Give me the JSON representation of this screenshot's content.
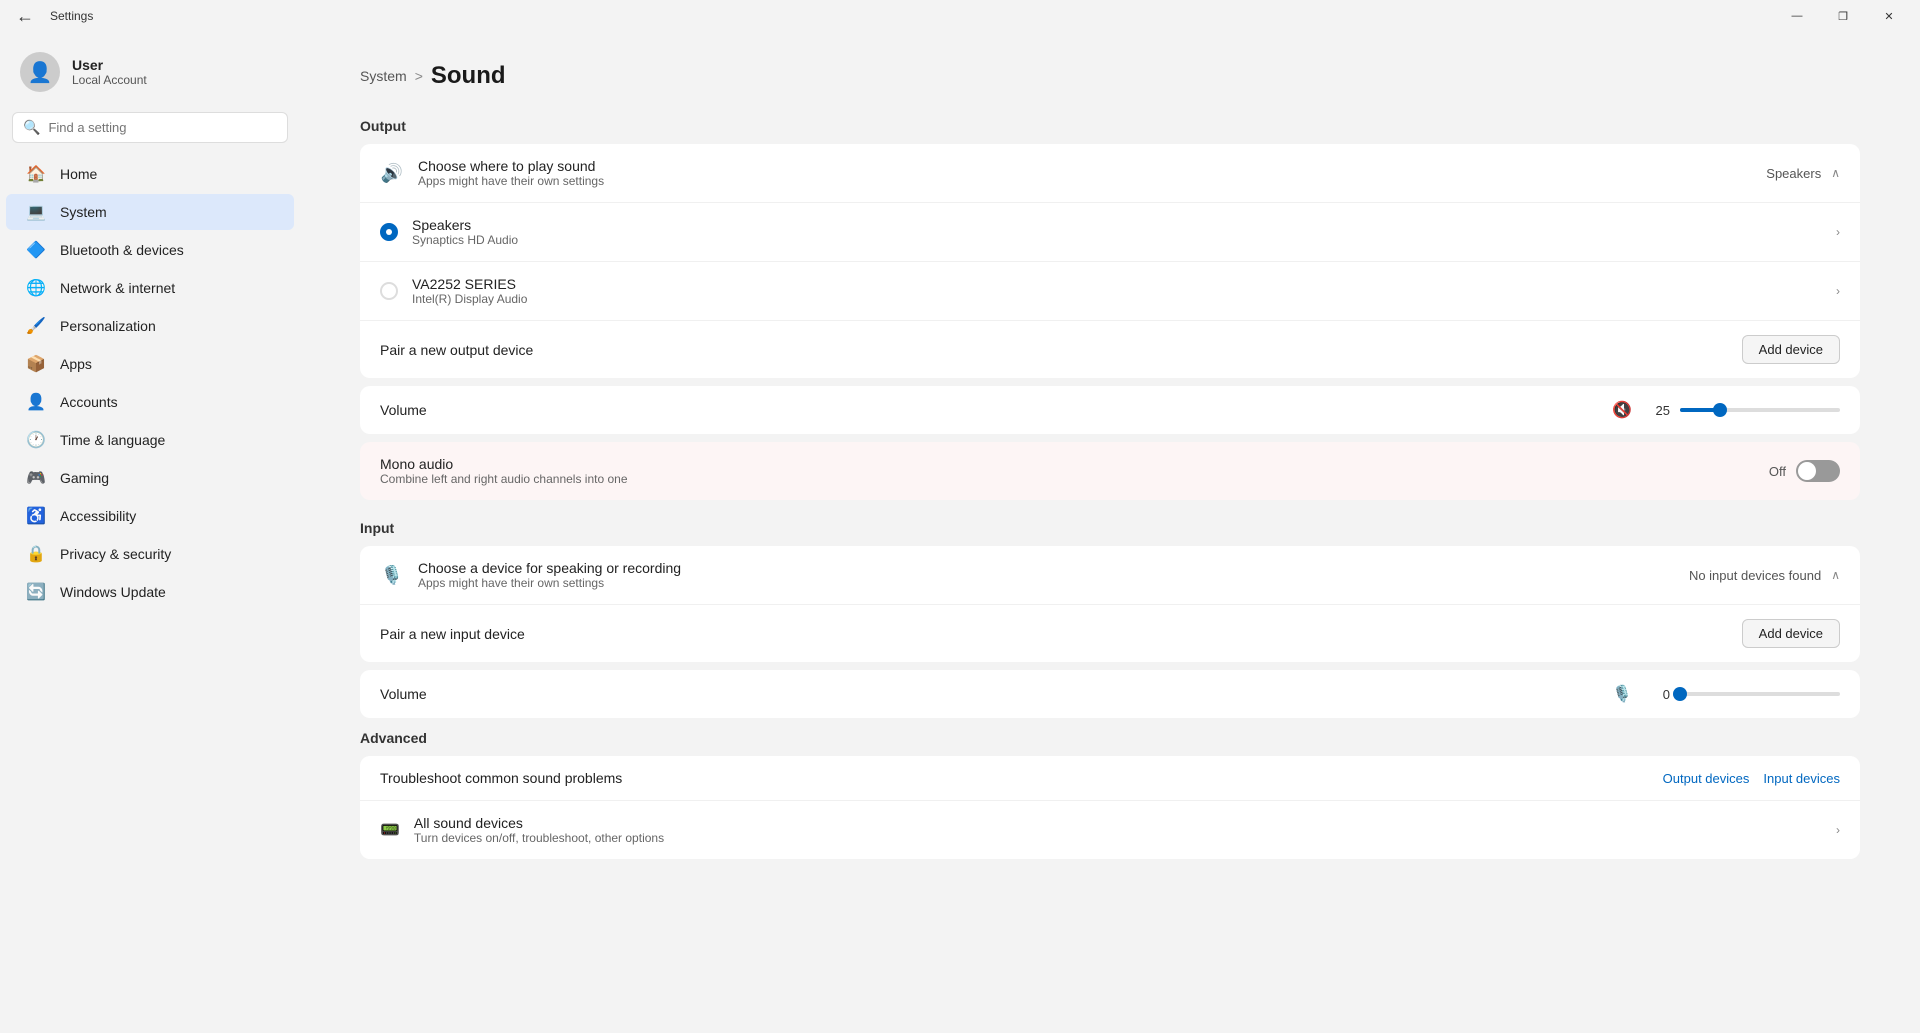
{
  "window": {
    "title": "Settings",
    "min_label": "—",
    "restore_label": "❐",
    "close_label": "✕"
  },
  "sidebar": {
    "search_placeholder": "Find a setting",
    "user": {
      "name": "User",
      "type": "Local Account"
    },
    "items": [
      {
        "id": "home",
        "label": "Home",
        "icon": "🏠"
      },
      {
        "id": "system",
        "label": "System",
        "icon": "💻",
        "active": true
      },
      {
        "id": "bluetooth",
        "label": "Bluetooth & devices",
        "icon": "🔵"
      },
      {
        "id": "network",
        "label": "Network & internet",
        "icon": "🌐"
      },
      {
        "id": "personalization",
        "label": "Personalization",
        "icon": "🖌️"
      },
      {
        "id": "apps",
        "label": "Apps",
        "icon": "📦"
      },
      {
        "id": "accounts",
        "label": "Accounts",
        "icon": "👤"
      },
      {
        "id": "time",
        "label": "Time & language",
        "icon": "🕐"
      },
      {
        "id": "gaming",
        "label": "Gaming",
        "icon": "🎮"
      },
      {
        "id": "accessibility",
        "label": "Accessibility",
        "icon": "♿"
      },
      {
        "id": "privacy",
        "label": "Privacy & security",
        "icon": "🔒"
      },
      {
        "id": "update",
        "label": "Windows Update",
        "icon": "🔄"
      }
    ]
  },
  "breadcrumb": {
    "parent": "System",
    "separator": ">",
    "current": "Sound"
  },
  "output": {
    "section_title": "Output",
    "choose_label": "Choose where to play sound",
    "choose_sub": "Apps might have their own settings",
    "choose_value": "Speakers",
    "speakers": {
      "label": "Speakers",
      "sub": "Synaptics HD Audio",
      "selected": true
    },
    "va2252": {
      "label": "VA2252 SERIES",
      "sub": "Intel(R) Display Audio",
      "selected": false
    },
    "pair_label": "Pair a new output device",
    "add_device_label": "Add device",
    "volume_label": "Volume",
    "volume_value": "25",
    "volume_percent": 25
  },
  "mono": {
    "label": "Mono audio",
    "sub": "Combine left and right audio channels into one",
    "state": "Off",
    "on": false
  },
  "input": {
    "section_title": "Input",
    "choose_label": "Choose a device for speaking or recording",
    "choose_sub": "Apps might have their own settings",
    "choose_value": "No input devices found",
    "pair_label": "Pair a new input device",
    "add_device_label": "Add device",
    "volume_label": "Volume",
    "volume_value": "0",
    "volume_percent": 0
  },
  "advanced": {
    "section_title": "Advanced",
    "troubleshoot_label": "Troubleshoot common sound problems",
    "output_devices_link": "Output devices",
    "input_devices_link": "Input devices",
    "all_devices_label": "All sound devices",
    "all_devices_sub": "Turn devices on/off, troubleshoot, other options"
  }
}
